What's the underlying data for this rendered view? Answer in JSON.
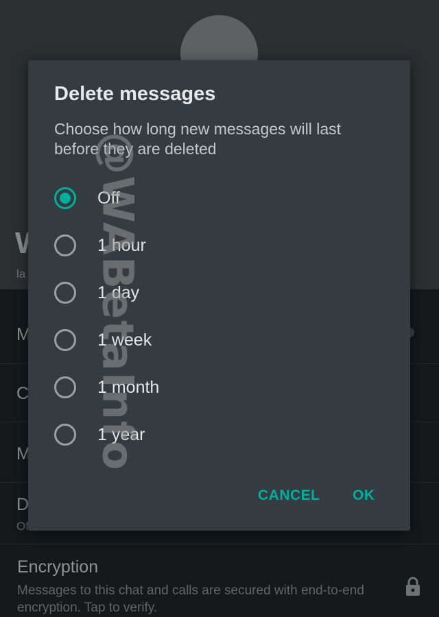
{
  "dialog": {
    "title": "Delete messages",
    "description": "Choose how long new messages will last before they are deleted",
    "options": [
      {
        "label": "Off",
        "selected": true
      },
      {
        "label": "1 hour",
        "selected": false
      },
      {
        "label": "1 day",
        "selected": false
      },
      {
        "label": "1 week",
        "selected": false
      },
      {
        "label": "1 month",
        "selected": false
      },
      {
        "label": "1 year",
        "selected": false
      }
    ],
    "cancel_label": "CANCEL",
    "ok_label": "OK"
  },
  "background": {
    "name_fragment": "W",
    "last_seen_fragment": "la",
    "rows": [
      {
        "label_fragment": "M",
        "sub_fragment": ""
      },
      {
        "label_fragment": "C",
        "sub_fragment": ""
      },
      {
        "label_fragment": "M",
        "sub_fragment": ""
      },
      {
        "label_fragment": "D",
        "sub_fragment": "Of"
      }
    ],
    "encryption": {
      "title": "Encryption",
      "description": "Messages to this chat and calls are secured with end-to-end encryption. Tap to verify."
    }
  },
  "watermark": "@WABetaInfo",
  "icons": {
    "lock": "lock-icon"
  },
  "colors": {
    "accent": "#00af9c",
    "dialog_bg": "#343c42",
    "screen_bg": "#15191b"
  }
}
